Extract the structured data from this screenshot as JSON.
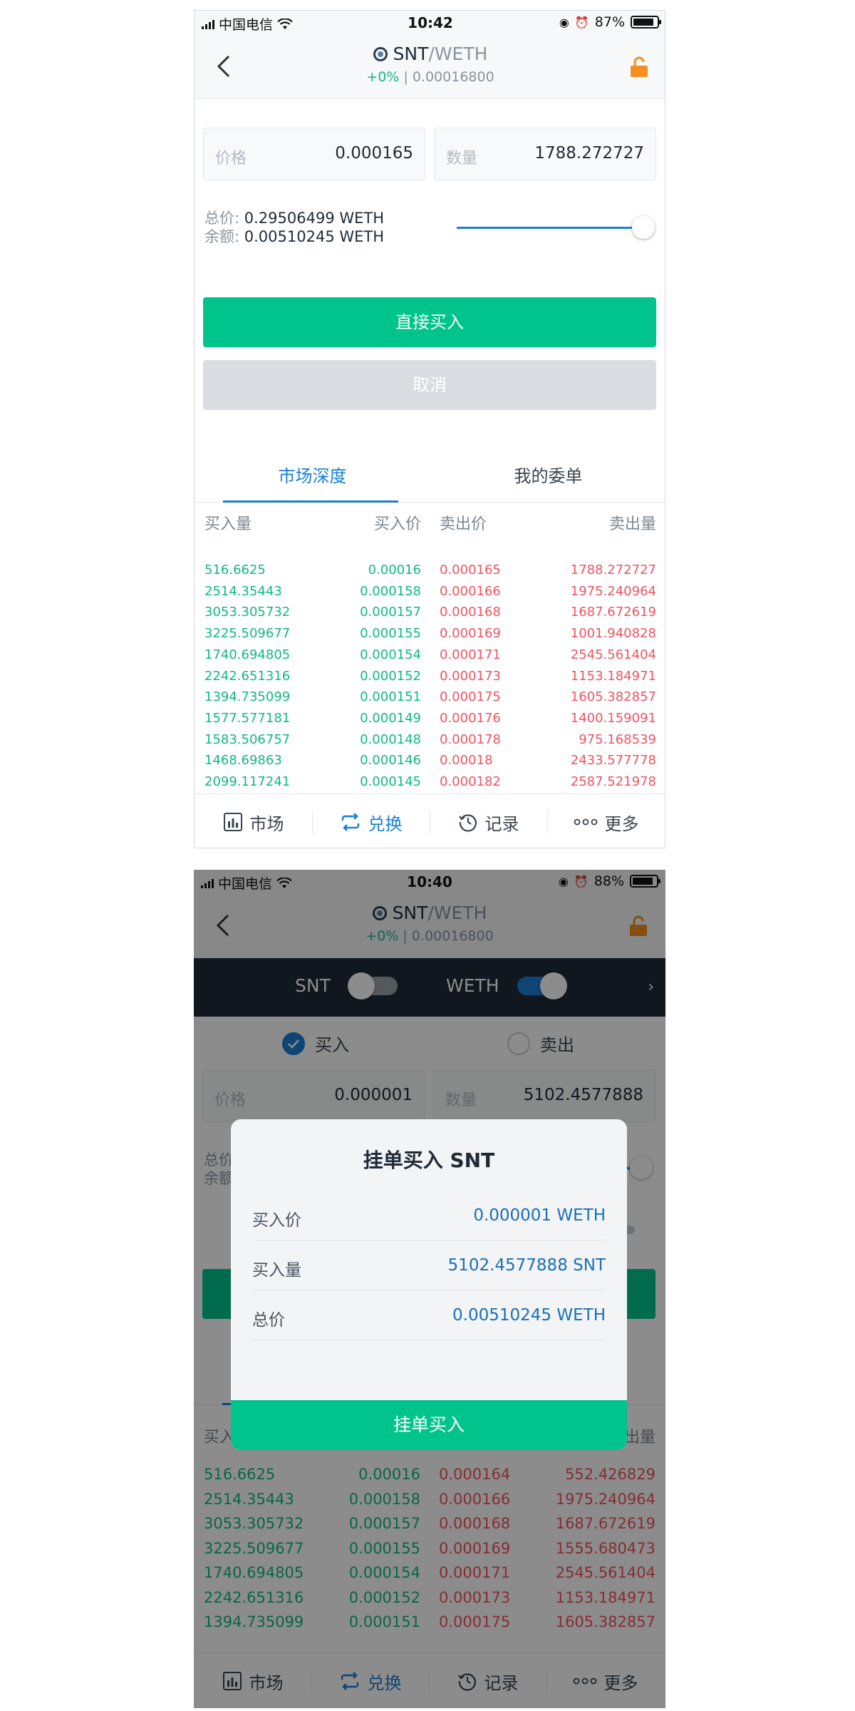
{
  "screen1": {
    "status": {
      "carrier": "中国电信",
      "time": "10:42",
      "battery": "87%",
      "battery_level": 0.87
    },
    "nav": {
      "base": "SNT",
      "quote": "/WETH",
      "change": "+0%",
      "separator": " | ",
      "last_price": "0.00016800"
    },
    "form": {
      "price_placeholder": "价格",
      "price_value": "0.000165",
      "qty_placeholder": "数量",
      "qty_value": "1788.272727",
      "total_label": "总价:",
      "total_value": "0.29506499 WETH",
      "balance_label": "余额:",
      "balance_value": "0.00510245 WETH",
      "slider_level": 1.0
    },
    "buy_button": "直接买入",
    "cancel_button": "取消",
    "tabs": [
      "市场深度",
      "我的委单"
    ],
    "orderbook": {
      "headers": [
        "买入量",
        "买入价",
        "卖出价",
        "卖出量"
      ],
      "rows": [
        [
          "516.6625",
          "0.00016",
          "0.000165",
          "1788.272727"
        ],
        [
          "2514.35443",
          "0.000158",
          "0.000166",
          "1975.240964"
        ],
        [
          "3053.305732",
          "0.000157",
          "0.000168",
          "1687.672619"
        ],
        [
          "3225.509677",
          "0.000155",
          "0.000169",
          "1001.940828"
        ],
        [
          "1740.694805",
          "0.000154",
          "0.000171",
          "2545.561404"
        ],
        [
          "2242.651316",
          "0.000152",
          "0.000173",
          "1153.184971"
        ],
        [
          "1394.735099",
          "0.000151",
          "0.000175",
          "1605.382857"
        ],
        [
          "1577.577181",
          "0.000149",
          "0.000176",
          "1400.159091"
        ],
        [
          "1583.506757",
          "0.000148",
          "0.000178",
          "975.168539"
        ],
        [
          "1468.69863",
          "0.000146",
          "0.00018",
          "2433.577778"
        ],
        [
          "2099.117241",
          "0.000145",
          "0.000182",
          "2587.521978"
        ]
      ]
    },
    "tabbar": [
      "市场",
      "兑换",
      "记录",
      "更多"
    ]
  },
  "screen2": {
    "status": {
      "carrier": "中国电信",
      "time": "10:40",
      "battery": "88%",
      "battery_level": 0.88
    },
    "nav": {
      "base": "SNT",
      "quote": "/WETH",
      "change": "+0%",
      "separator": " | ",
      "last_price": "0.00016800"
    },
    "toggles": {
      "left_label": "SNT",
      "right_label": "WETH"
    },
    "radio": {
      "buy": "买入",
      "sell": "卖出"
    },
    "form": {
      "price_placeholder": "价格",
      "price_value": "0.000001",
      "qty_placeholder": "数量",
      "qty_value": "5102.4577888",
      "total_label": "总价",
      "balance_label": "余额"
    },
    "partial_header": {
      "left": "买入",
      "right": "出量"
    },
    "orderbook_rows": [
      [
        "516.6625",
        "0.00016",
        "0.000164",
        "552.426829"
      ],
      [
        "2514.35443",
        "0.000158",
        "0.000166",
        "1975.240964"
      ],
      [
        "3053.305732",
        "0.000157",
        "0.000168",
        "1687.672619"
      ],
      [
        "3225.509677",
        "0.000155",
        "0.000169",
        "1555.680473"
      ],
      [
        "1740.694805",
        "0.000154",
        "0.000171",
        "2545.561404"
      ],
      [
        "2242.651316",
        "0.000152",
        "0.000173",
        "1153.184971"
      ],
      [
        "1394.735099",
        "0.000151",
        "0.000175",
        "1605.382857"
      ]
    ],
    "modal": {
      "title": "挂单买入 SNT",
      "rows": [
        {
          "label": "买入价",
          "value": "0.000001 WETH"
        },
        {
          "label": "买入量",
          "value": "5102.4577888 SNT"
        },
        {
          "label": "总价",
          "value": "0.00510245 WETH"
        }
      ],
      "confirm": "挂单买入"
    },
    "tabbar": [
      "市场",
      "兑换",
      "记录",
      "更多"
    ]
  },
  "colors": {
    "green": "#00c48c",
    "red": "#f0535f",
    "blue": "#1a7fd4",
    "orange": "#f5901e",
    "dark": "#1f2b3a"
  }
}
